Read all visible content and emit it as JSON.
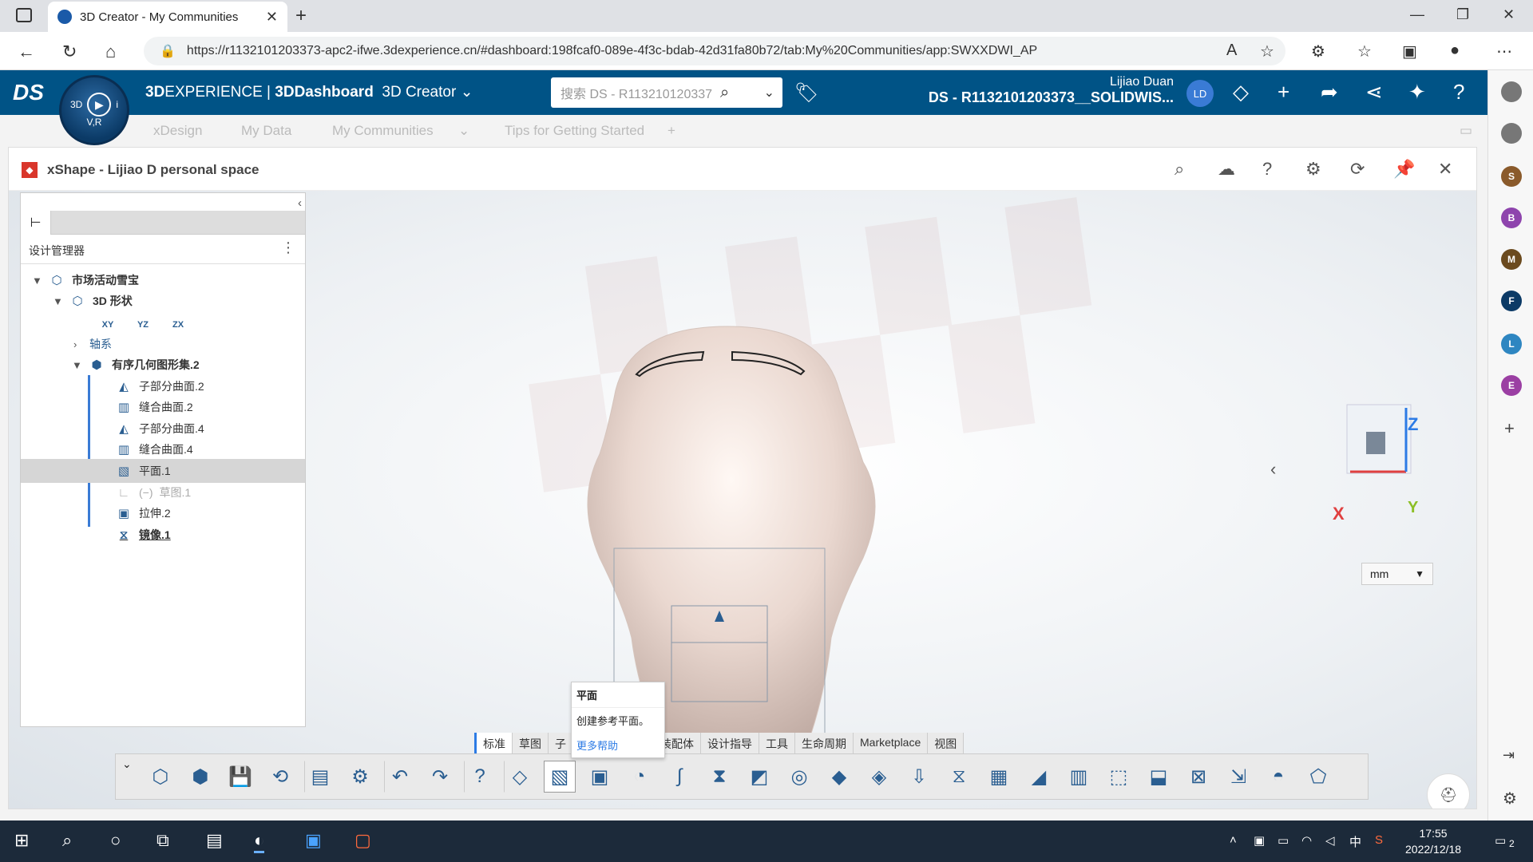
{
  "browser": {
    "tab_title": "3D Creator - My Communities",
    "url": "https://r1132101203373-apc2-ifwe.3dexperience.cn/#dashboard:198fcaf0-089e-4f3c-bdab-42d31fa80b72/tab:My%20Communities/app:SWXXDWI_AP"
  },
  "topbar": {
    "brand_prefix": "3D",
    "brand_main": "EXPERIENCE | ",
    "dashboard": "3DDashboard",
    "app": "3D Creator",
    "search_placeholder": "搜索 DS - R113210120337",
    "user_name": "Lijiao Duan",
    "tenant": "DS - R1132101203373__SOLIDWIS...",
    "avatar_initials": "LD",
    "compass_tl": "3D",
    "compass_tr": "i",
    "compass_bottom": "V,R"
  },
  "dashtabs": [
    "xDesign",
    "My Data",
    "My Communities",
    "Tips for Getting Started"
  ],
  "panel": {
    "title": "xShape - Lijiao D personal space"
  },
  "tree": {
    "manager_label": "设计管理器",
    "nodes": [
      {
        "label": "市场活动雪宝"
      },
      {
        "label": "3D 形状"
      },
      {
        "label": "轴系"
      },
      {
        "label": "有序几何图形集.2"
      },
      {
        "label": "子部分曲面.2"
      },
      {
        "label": "缝合曲面.2"
      },
      {
        "label": "子部分曲面.4"
      },
      {
        "label": "缝合曲面.4"
      },
      {
        "label": "平面.1"
      },
      {
        "label": "草图.1"
      },
      {
        "label": "拉伸.2"
      },
      {
        "label": "镜像.1"
      }
    ],
    "plane_labels": [
      "XY",
      "YZ",
      "ZX"
    ],
    "hidden_mark": "(−)"
  },
  "viewport": {
    "axis_z": "Z",
    "axis_x": "X",
    "axis_y": "Y",
    "unit": "mm"
  },
  "tooltip": {
    "title": "平面",
    "desc": "创建参考平面。",
    "help": "更多帮助"
  },
  "toolbar_tabs": [
    "标准",
    "草图",
    "子",
    "面",
    "装配体",
    "设计指导",
    "工具",
    "生命周期",
    "Marketplace",
    "视图"
  ],
  "taskbar": {
    "time": "17:55",
    "date": "2022/12/18",
    "lang": "中",
    "notif_count": "2"
  },
  "right_sidebar": [
    {
      "letter": "",
      "color": "#777777"
    },
    {
      "letter": "",
      "color": "#777777"
    },
    {
      "letter": "S",
      "color": "#8a5a2b"
    },
    {
      "letter": "B",
      "color": "#8e44ad"
    },
    {
      "letter": "M",
      "color": "#6b4a1e"
    },
    {
      "letter": "F",
      "color": "#0b3a66"
    },
    {
      "letter": "L",
      "color": "#2e86c1"
    },
    {
      "letter": "E",
      "color": "#9b3fa3"
    }
  ]
}
